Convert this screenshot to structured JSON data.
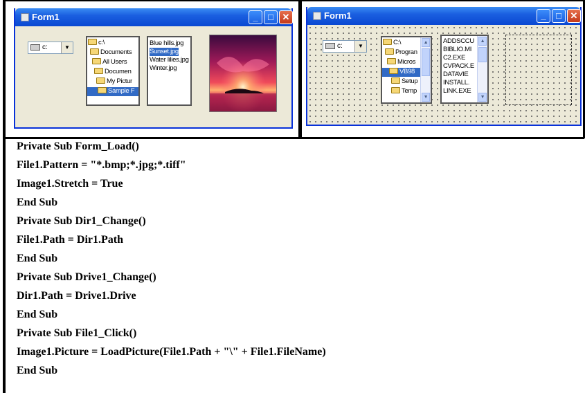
{
  "left_form": {
    "title": "Form1",
    "drive": "c:",
    "directories": [
      {
        "label": "c:\\",
        "selected": false
      },
      {
        "label": "Documents",
        "selected": false
      },
      {
        "label": "All Users",
        "selected": false
      },
      {
        "label": "Documen",
        "selected": false
      },
      {
        "label": "My Pictur",
        "selected": false
      },
      {
        "label": "Sample F",
        "selected": true
      }
    ],
    "files": [
      {
        "label": "Blue hills.jpg",
        "selected": false
      },
      {
        "label": "Sunset.jpg",
        "selected": true
      },
      {
        "label": "Water lilies.jpg",
        "selected": false
      },
      {
        "label": "Winter.jpg",
        "selected": false
      }
    ]
  },
  "right_form": {
    "title": "Form1",
    "drive": "c:",
    "directories": [
      {
        "label": "C:\\",
        "selected": false
      },
      {
        "label": "Progran",
        "selected": false
      },
      {
        "label": "Micros",
        "selected": false
      },
      {
        "label": "VB98",
        "selected": true
      },
      {
        "label": "Setup",
        "selected": false
      },
      {
        "label": "Temp",
        "selected": false
      }
    ],
    "files": [
      {
        "label": "ADDSCCU",
        "selected": false
      },
      {
        "label": "BIBLIO.MI",
        "selected": false
      },
      {
        "label": "C2.EXE",
        "selected": false
      },
      {
        "label": "CVPACK.E",
        "selected": false
      },
      {
        "label": "DATAVIE",
        "selected": false
      },
      {
        "label": "INSTALL.",
        "selected": false
      },
      {
        "label": "LINK.EXE",
        "selected": false
      }
    ]
  },
  "window_buttons": {
    "minimize": "_",
    "maximize": "□",
    "close": "✕"
  },
  "scroll_arrows": {
    "up": "▲",
    "down": "▼"
  },
  "combo_arrow": "▼",
  "colors": {
    "titlebar": "#0a48d2",
    "selection": "#316ac5",
    "window_bg": "#ece9d8"
  },
  "code_lines": [
    "Private Sub Form_Load()",
    "File1.Pattern = \"*.bmp;*.jpg;*.tiff\"",
    "Image1.Stretch = True",
    "End Sub",
    "Private Sub Dir1_Change()",
    "File1.Path = Dir1.Path",
    "End Sub",
    "Private Sub Drive1_Change()",
    "Dir1.Path = Drive1.Drive",
    "End Sub",
    "Private Sub File1_Click()",
    "Image1.Picture = LoadPicture(File1.Path + \"\\\" + File1.FileName)",
    "End Sub"
  ]
}
